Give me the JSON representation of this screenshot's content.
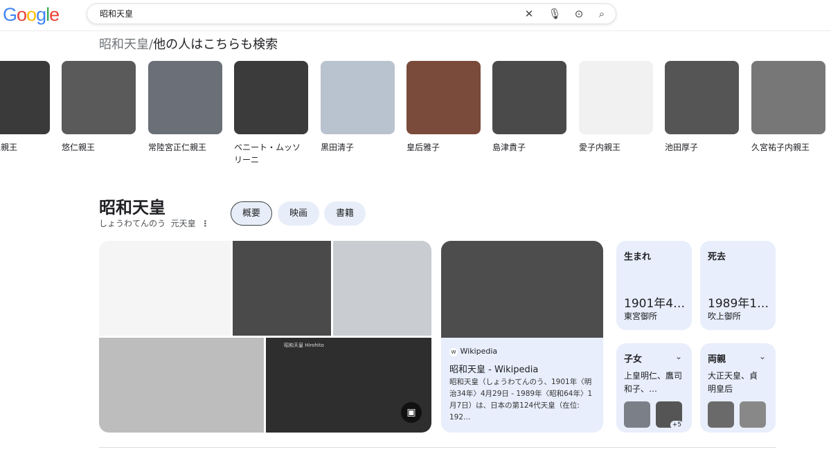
{
  "header": {
    "logo": "Google",
    "query": "昭和天皇"
  },
  "people": {
    "title_query": "昭和天皇",
    "title_sep": "/",
    "title_rest": "他の人はこちらも検索",
    "items": [
      "宮崇仁親王",
      "悠仁親王",
      "常陸宮正仁親王",
      "ベニート・ムッソリーニ",
      "黒田清子",
      "皇后雅子",
      "島津貴子",
      "愛子内親王",
      "池田厚子",
      "久宮祐子内親王"
    ]
  },
  "kp": {
    "title": "昭和天皇",
    "reading": "しょうわてんのう",
    "type": "元天皇",
    "tabs": [
      "概要",
      "映画",
      "書籍"
    ],
    "wiki": {
      "source": "Wikipedia",
      "title": "昭和天皇 - Wikipedia",
      "snippet": "昭和天皇（しょうわてんのう、1901年〈明治34年〉4月29日 - 1989年〈昭和64年〉1月7日）は、日本の第124代天皇（在位: 192…"
    },
    "born": {
      "label": "生まれ",
      "value": "1901年4…",
      "place": "東宮御所"
    },
    "died": {
      "label": "死去",
      "value": "1989年1…",
      "place": "吹上御所"
    },
    "children": {
      "label": "子女",
      "value": "上皇明仁、鷹司和子、…",
      "more": "+5"
    },
    "parents": {
      "label": "両親",
      "value": "大正天皇、貞明皇后"
    },
    "image_overlay": "昭和天皇 Hirohito"
  }
}
